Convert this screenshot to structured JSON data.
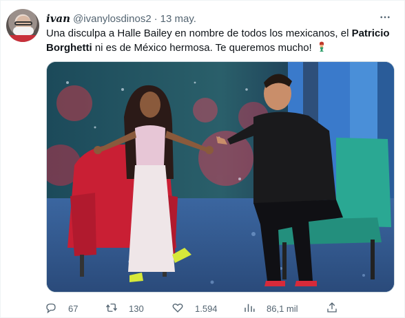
{
  "tweet": {
    "display_name": "ivan",
    "handle": "@ivanylosdinos2",
    "separator": "·",
    "date": "13 may.",
    "text_part1": "Una disculpa a Halle Bailey en nombre de todos los mexicanos, el ",
    "text_bold": "Patricio Borghetti",
    "text_part2": " ni es de México hermosa. Te queremos mucho!",
    "emoji": "mermaid-emoji"
  },
  "actions": {
    "reply_count": "67",
    "retweet_count": "130",
    "like_count": "1.594",
    "views_count": "86,1 mil"
  },
  "icons": {
    "more": "more-icon",
    "reply": "reply-icon",
    "retweet": "retweet-icon",
    "like": "heart-icon",
    "views": "views-icon",
    "share": "share-icon"
  },
  "colors": {
    "text": "#0f1419",
    "muted": "#536471",
    "chair_red": "#d8263a",
    "chair_teal": "#2fb8a4"
  }
}
